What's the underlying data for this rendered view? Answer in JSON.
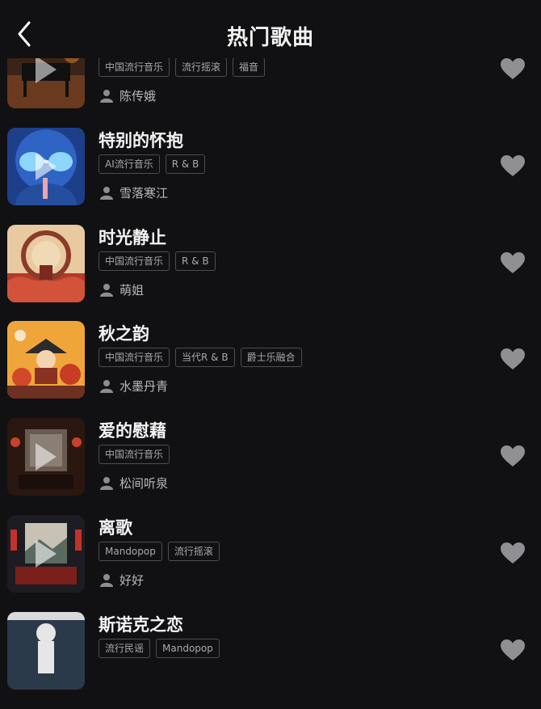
{
  "header": {
    "title": "热门歌曲",
    "back_icon": "chevron-left-icon"
  },
  "songs": [
    {
      "title": "",
      "tags": [
        "中国流行音乐",
        "流行摇滚",
        "福音"
      ],
      "artist": "陈传娥",
      "favorite_icon": "heart-icon"
    },
    {
      "title": "特别的怀抱",
      "tags": [
        "AI流行音乐",
        "R & B"
      ],
      "artist": "雪落寒江",
      "favorite_icon": "heart-icon"
    },
    {
      "title": "时光静止",
      "tags": [
        "中国流行音乐",
        "R & B"
      ],
      "artist": "萌姐",
      "favorite_icon": "heart-icon"
    },
    {
      "title": "秋之韵",
      "tags": [
        "中国流行音乐",
        "当代R & B",
        "爵士乐融合"
      ],
      "artist": "水墨丹青",
      "favorite_icon": "heart-icon"
    },
    {
      "title": "爱的慰藉",
      "tags": [
        "中国流行音乐"
      ],
      "artist": "松间听泉",
      "favorite_icon": "heart-icon"
    },
    {
      "title": "离歌",
      "tags": [
        "Mandopop",
        "流行摇滚"
      ],
      "artist": "好好",
      "favorite_icon": "heart-icon"
    },
    {
      "title": "斯诺克之恋",
      "tags": [
        "流行民谣",
        "Mandopop"
      ],
      "artist": "",
      "favorite_icon": "heart-icon"
    }
  ]
}
